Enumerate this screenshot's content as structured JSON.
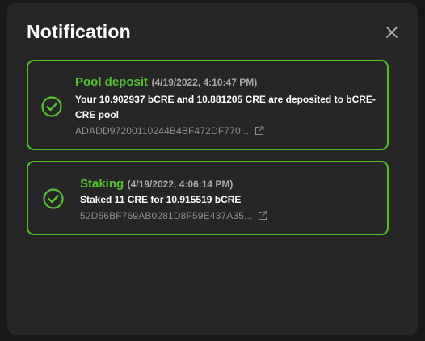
{
  "modal": {
    "title": "Notification",
    "close_icon": "close-icon"
  },
  "colors": {
    "accent_green": "#53c22b",
    "card_border": "#4fbf26",
    "background": "#262626",
    "text_primary": "#ffffff",
    "text_muted": "#8d8d8d"
  },
  "notifications": [
    {
      "type": "Pool deposit",
      "time": "(4/19/2022, 4:10:47 PM)",
      "description": "Your 10.902937 bCRE and 10.881205 CRE are deposited to bCRE-CRE pool",
      "tx_hash": "ADADD97200110244B4BF472DF770...",
      "status_icon": "check-circle-icon",
      "link_icon": "external-link-icon"
    },
    {
      "type": "Staking",
      "time": "(4/19/2022, 4:06:14 PM)",
      "description": "Staked 11 CRE for 10.915519 bCRE",
      "tx_hash": "52D56BF769AB0281D8F59E437A35...",
      "status_icon": "check-circle-icon",
      "link_icon": "external-link-icon"
    }
  ]
}
